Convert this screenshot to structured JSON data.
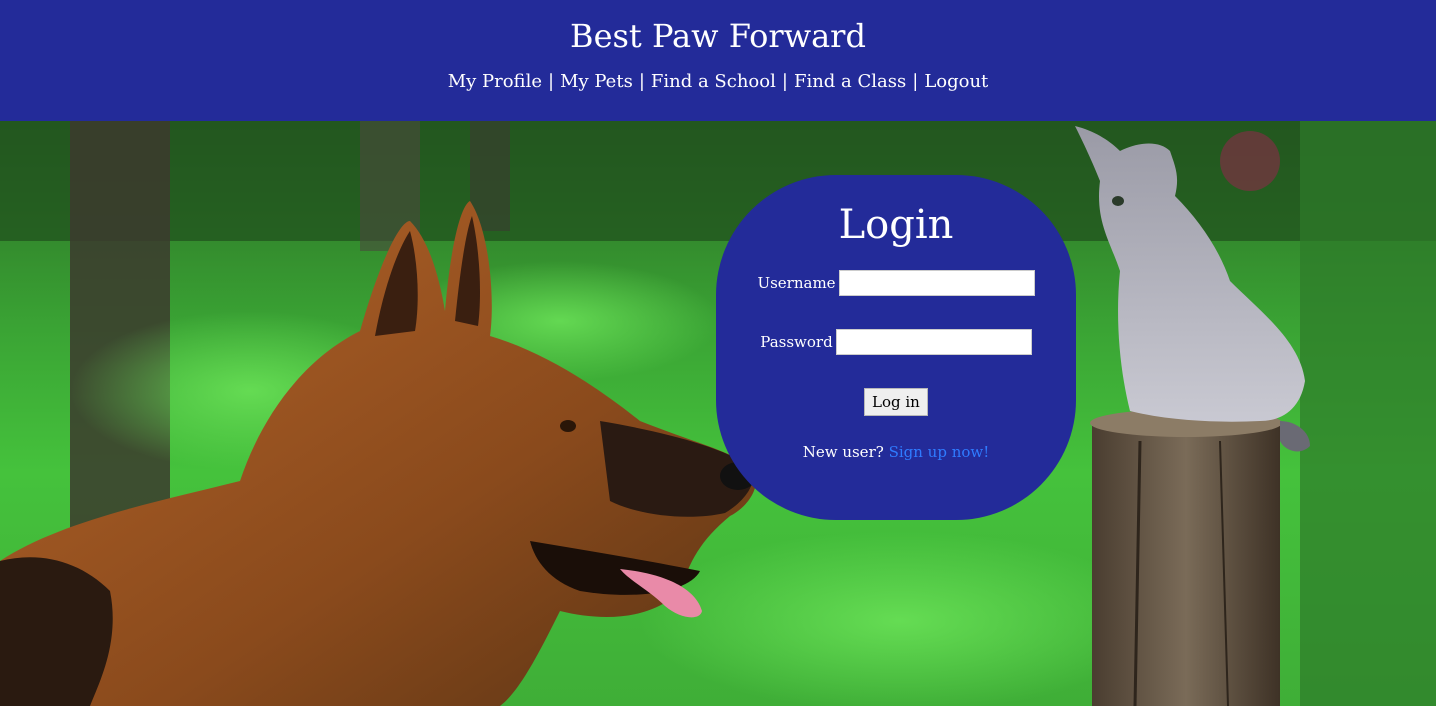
{
  "header": {
    "title": "Best Paw Forward",
    "nav": [
      {
        "label": "My Profile"
      },
      {
        "label": "My Pets"
      },
      {
        "label": "Find a School"
      },
      {
        "label": "Find a Class"
      },
      {
        "label": "Logout"
      }
    ],
    "separator": "|"
  },
  "login": {
    "title": "Login",
    "username_label": "Username",
    "username_value": "",
    "password_label": "Password",
    "password_value": "",
    "submit_label": "Log in",
    "signup_prompt": "New user?",
    "signup_link": "Sign up now!"
  },
  "colors": {
    "header_bg": "#232b99",
    "panel_bg": "#232b99",
    "link": "#2f7bff",
    "grass": "#45c23c"
  },
  "images": {
    "background": "dog-and-kitten-photo"
  }
}
